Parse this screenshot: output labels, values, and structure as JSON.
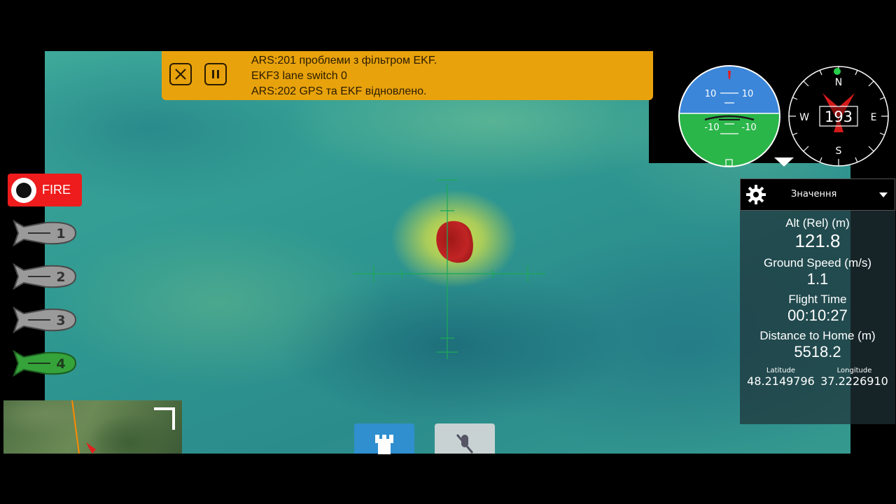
{
  "banner": {
    "lines": [
      "ARS:201 проблеми з фільтром EKF.",
      "EKF3 lane switch 0",
      "ARS:202 GPS та EKF відновлено."
    ],
    "close_icon": "close-icon",
    "pause_icon": "pause-icon",
    "color": "#e8a20c"
  },
  "fire_button": {
    "label": "FIRE",
    "color": "#ee1c1c"
  },
  "bombs": [
    {
      "label": "1",
      "state": "idle",
      "color": "#9a9a9a"
    },
    {
      "label": "2",
      "state": "idle",
      "color": "#9a9a9a"
    },
    {
      "label": "3",
      "state": "idle",
      "color": "#9a9a9a"
    },
    {
      "label": "4",
      "state": "selected",
      "color": "#35a33a"
    }
  ],
  "attitude": {
    "pitch_labels_top": [
      "10",
      "10"
    ],
    "pitch_labels_bottom": [
      "-10",
      "-10"
    ]
  },
  "compass": {
    "heading": "193",
    "cardinals": {
      "n": "N",
      "e": "E",
      "s": "S",
      "w": "W"
    }
  },
  "telemetry": {
    "dropdown_label": "Значення",
    "settings_icon": "gear-icon",
    "items": [
      {
        "label": "Alt (Rel) (m)",
        "value": "121.8"
      },
      {
        "label": "Ground Speed (m/s)",
        "value": "1.1"
      },
      {
        "label": "Flight Time",
        "value": "00:10:27"
      },
      {
        "label": "Distance to Home (m)",
        "value": "5518.2"
      }
    ],
    "latitude_label": "Latitude",
    "latitude": "48.2149796",
    "longitude_label": "Longitude",
    "longitude": "37.2226910"
  },
  "bottom_buttons": [
    {
      "icon": "castle-icon",
      "color": "#2f8fcf"
    },
    {
      "icon": "mic-off-icon",
      "color": "#c8d2d2"
    }
  ]
}
